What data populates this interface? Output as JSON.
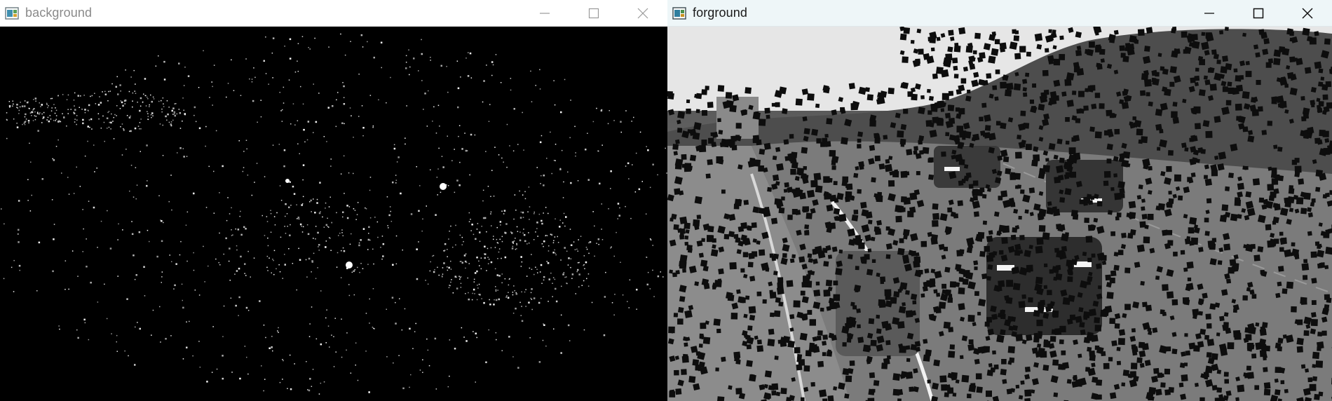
{
  "windows": [
    {
      "title": "background",
      "state": "inactive",
      "icon": "opencv-window-icon",
      "controls": {
        "minimize": "minimize-icon",
        "maximize": "maximize-icon",
        "close": "close-icon"
      },
      "image_description_icon": "binary-mask-image"
    },
    {
      "title": "forground",
      "state": "active",
      "icon": "opencv-window-icon",
      "controls": {
        "minimize": "minimize-icon",
        "maximize": "maximize-icon",
        "close": "close-icon"
      },
      "image_description_icon": "grayscale-traffic-image"
    }
  ],
  "colors": {
    "inactive_title_text": "#8a8a8a",
    "active_title_text": "#1a1a1a",
    "active_titlebar_bg": "#eef6f8",
    "inactive_titlebar_bg": "#ffffff"
  }
}
